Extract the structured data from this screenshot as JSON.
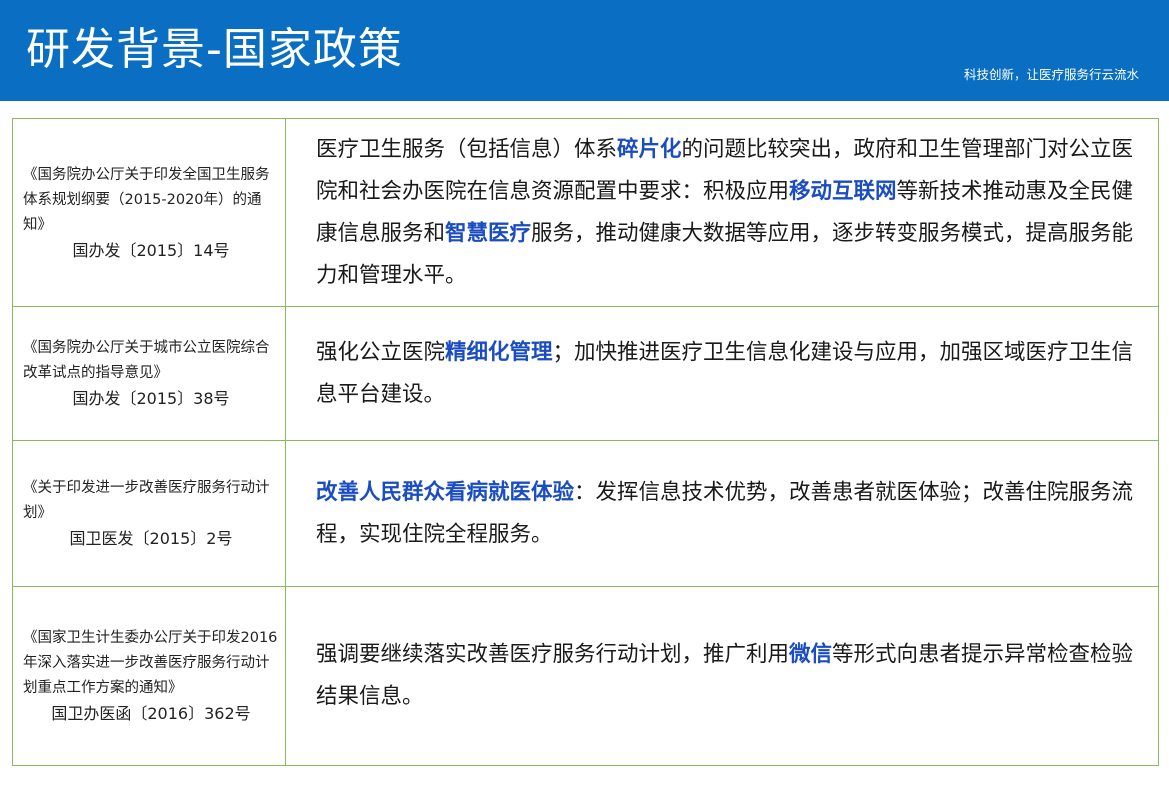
{
  "header": {
    "title": "研发背景-国家政策",
    "slogan": "科技创新，让医疗服务行云流水",
    "background_color": "#0a6fc2"
  },
  "table": {
    "border_color": "#8aba5e",
    "highlight_color": "#1a4dc2",
    "rows": [
      {
        "doc_title": "《国务院办公厅关于印发全国卫生服务体系规划纲要（2015-2020年）的通知》",
        "doc_no": "国办发〔2015〕14号",
        "desc": [
          {
            "text": "医疗卫生服务（包括信息）体系"
          },
          {
            "text": "碎片化",
            "hl": true
          },
          {
            "text": "的问题比较突出，政府和卫生管理部门对公立医院和社会办医院在信息资源配置中要求：积极应用"
          },
          {
            "text": "移动互联网",
            "hl": true
          },
          {
            "text": "等新技术推动惠及全民健康信息服务和"
          },
          {
            "text": "智慧医疗",
            "hl": true
          },
          {
            "text": "服务，推动健康大数据等应用，逐步转变服务模式，提高服务能力和管理水平。"
          }
        ]
      },
      {
        "doc_title": "《国务院办公厅关于城市公立医院综合改革试点的指导意见》",
        "doc_no": "国办发〔2015〕38号",
        "desc": [
          {
            "text": "强化公立医院"
          },
          {
            "text": "精细化管理",
            "hl": true
          },
          {
            "text": "；加快推进医疗卫生信息化建设与应用，加强区域医疗卫生信息平台建设。"
          }
        ]
      },
      {
        "doc_title": "《关于印发进一步改善医疗服务行动计划》",
        "doc_no": "国卫医发〔2015〕2号",
        "desc": [
          {
            "text": "改善人民群众看病就医体验",
            "hl": true
          },
          {
            "text": "：发挥信息技术优势，改善患者就医体验；改善住院服务流程，实现住院全程服务。"
          }
        ]
      },
      {
        "doc_title": "《国家卫生计生委办公厅关于印发2016年深入落实进一步改善医疗服务行动计划重点工作方案的通知》",
        "doc_no": "国卫办医函〔2016〕362号",
        "desc": [
          {
            "text": "强调要继续落实改善医疗服务行动计划，推广利用"
          },
          {
            "text": "微信",
            "hl": true
          },
          {
            "text": "等形式向患者提示异常检查检验结果信息。"
          }
        ]
      }
    ]
  }
}
